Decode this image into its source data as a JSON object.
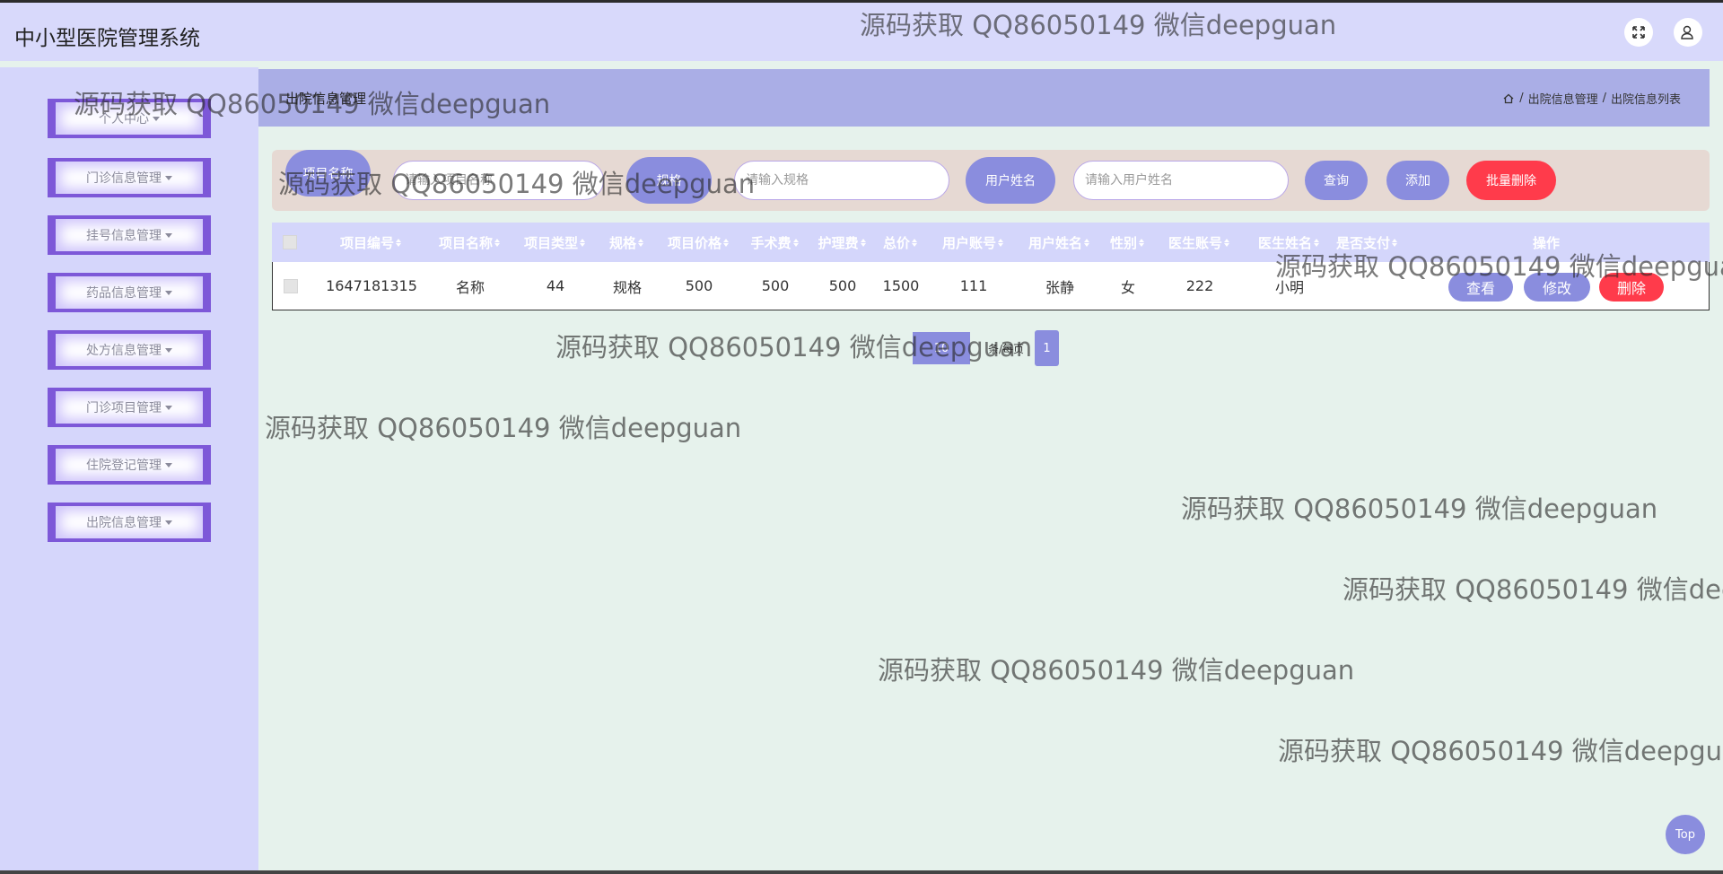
{
  "app": {
    "title": "中小型医院管理系统"
  },
  "topbar_icons": [
    "fullscreen-icon",
    "user-icon"
  ],
  "sidebar": {
    "items": [
      {
        "label": "个人中心"
      },
      {
        "label": "门诊信息管理"
      },
      {
        "label": "挂号信息管理"
      },
      {
        "label": "药品信息管理"
      },
      {
        "label": "处方信息管理"
      },
      {
        "label": "门诊项目管理"
      },
      {
        "label": "住院登记管理"
      },
      {
        "label": "出院信息管理"
      }
    ]
  },
  "page": {
    "title": "出院信息管理",
    "breadcrumb": [
      "出院信息管理",
      "出院信息列表"
    ],
    "breadcrumb_sep": "/"
  },
  "search": {
    "fields": [
      {
        "label": "项目名称",
        "placeholder": "请输入项目名称"
      },
      {
        "label": "规格",
        "placeholder": "请输入规格"
      },
      {
        "label": "用户姓名",
        "placeholder": "请输入用户姓名"
      }
    ],
    "query_label": "查询",
    "add_label": "添加",
    "batch_delete_label": "批量删除"
  },
  "table": {
    "columns": [
      "项目编号",
      "项目名称",
      "项目类型",
      "规格",
      "项目价格",
      "手术费",
      "护理费",
      "总价",
      "用户账号",
      "用户姓名",
      "性别",
      "医生账号",
      "医生姓名",
      "是否支付",
      "操作"
    ],
    "rows": [
      {
        "cells": [
          "1647181315",
          "名称",
          "44",
          "规格",
          "500",
          "500",
          "500",
          "1500",
          "111",
          "张静",
          "女",
          "222",
          "小明",
          ""
        ]
      }
    ],
    "actions": {
      "view": "查看",
      "edit": "修改",
      "delete": "删除"
    }
  },
  "pagination": {
    "page_size": "10",
    "per_page_label": "条/每页",
    "current_page": "1"
  },
  "back_to_top": "Top",
  "watermark_text": "源码获取 QQ86050149 微信deepguan",
  "colors": {
    "accent": "#8a8dde",
    "danger": "#ff3b4b",
    "sidebar": "#d5d6fb",
    "menu_border": "#7d58d8"
  }
}
